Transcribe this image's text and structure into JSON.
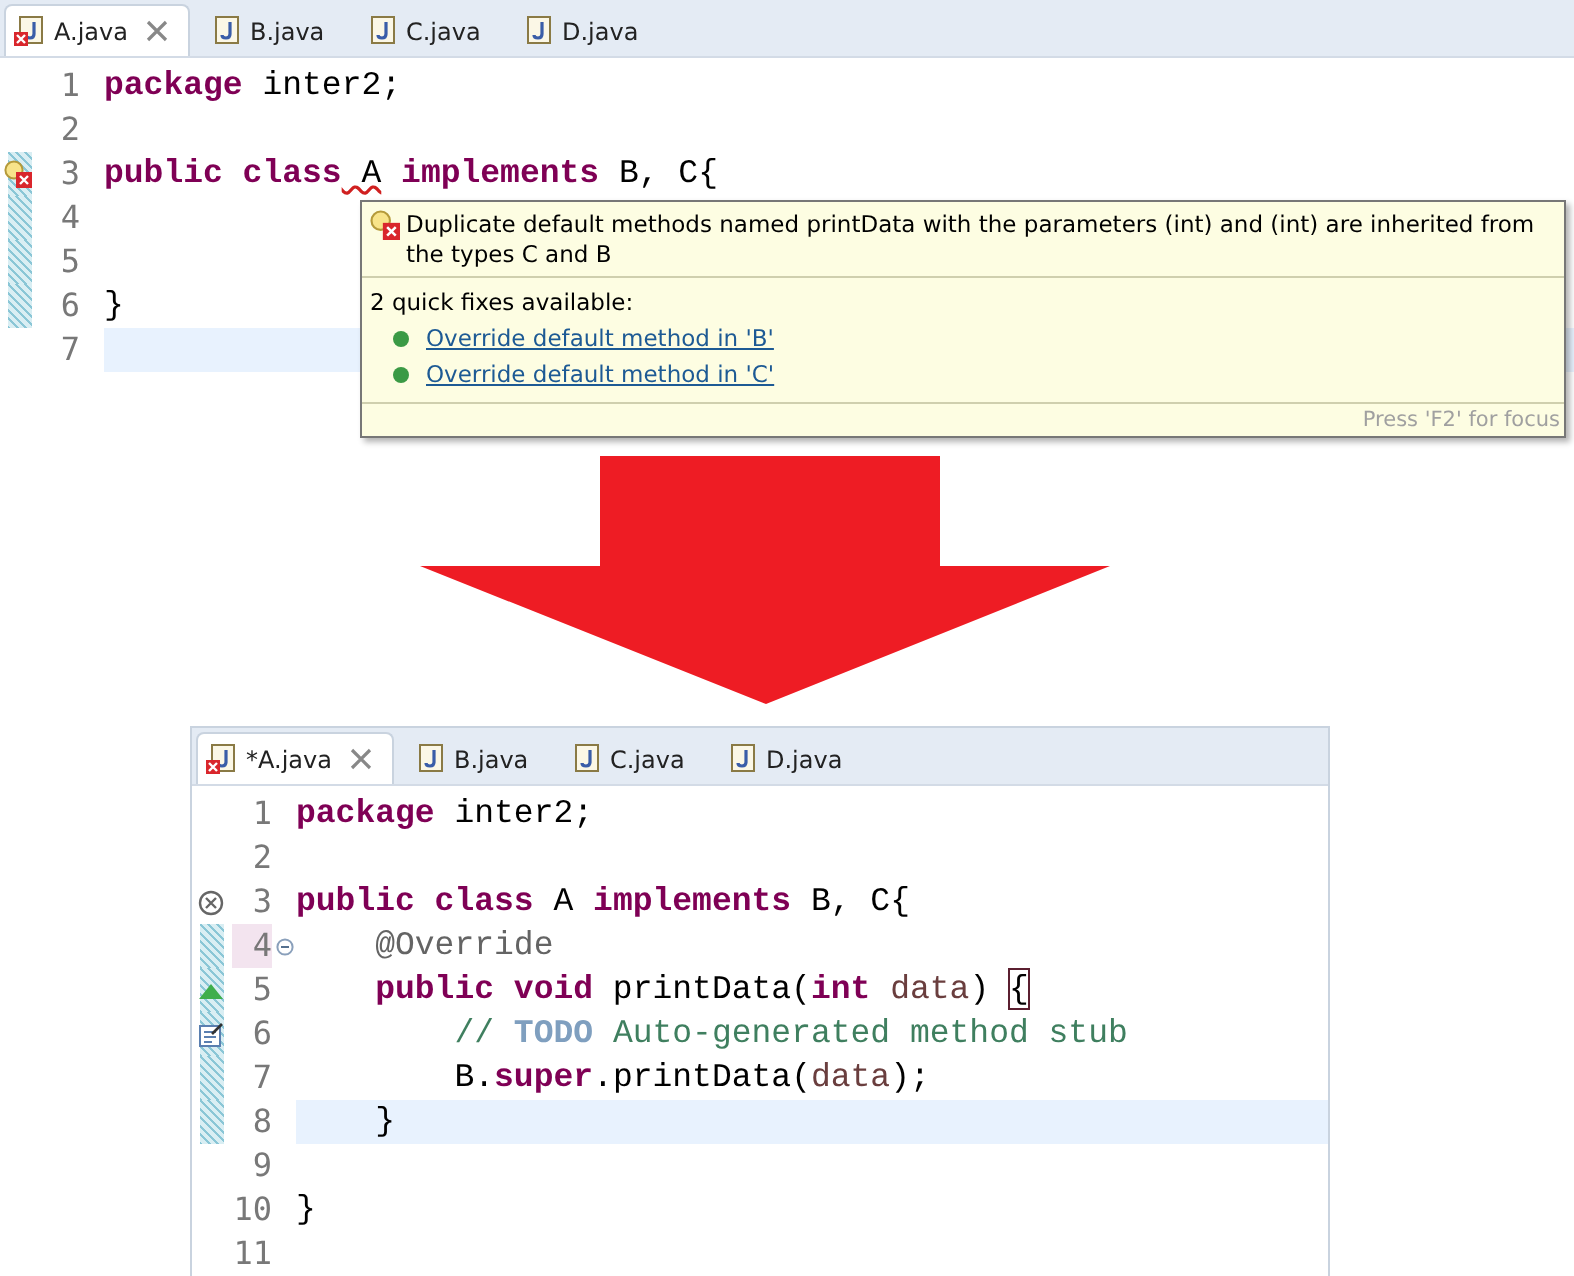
{
  "editors": [
    {
      "tabs": [
        {
          "label": "A.java",
          "selected": true,
          "error": true
        },
        {
          "label": "B.java",
          "selected": false,
          "error": false
        },
        {
          "label": "C.java",
          "selected": false,
          "error": false
        },
        {
          "label": "D.java",
          "selected": false,
          "error": false
        }
      ],
      "lines": [
        {
          "number": "1",
          "changed": false,
          "current": false,
          "fold": false,
          "tokens": [
            {
              "text": "package",
              "kind": "keyword"
            },
            {
              "text": " inter2;",
              "kind": "plain"
            }
          ]
        },
        {
          "number": "2",
          "changed": false,
          "current": false,
          "fold": false
        },
        {
          "number": "3",
          "changed": true,
          "current": false,
          "fold": false,
          "marker": {
            "kind": "bulb-error"
          },
          "tokens": [
            {
              "text": "public class",
              "kind": "keyword"
            },
            {
              "text": " A",
              "kind": "error"
            },
            {
              "text": " implements",
              "kind": "keyword"
            },
            {
              "text": " B, C{",
              "kind": "plain"
            }
          ]
        },
        {
          "number": "4",
          "changed": true,
          "current": false,
          "fold": false
        },
        {
          "number": "5",
          "changed": true,
          "current": false,
          "fold": false
        },
        {
          "number": "6",
          "changed": true,
          "current": false,
          "fold": false,
          "tokens": [
            {
              "text": "}",
              "kind": "plain"
            }
          ]
        },
        {
          "number": "7",
          "changed": false,
          "current": true,
          "fold": false
        }
      ],
      "tooltip": {
        "message": "Duplicate default methods named printData with the parameters (int) and (int) are inherited from the types C and B",
        "heading": "2 quick fixes available:",
        "fixes": [
          "Override default method in 'B'",
          "Override default method in 'C'"
        ],
        "footer": "Press 'F2' for focus"
      }
    },
    {
      "tabs": [
        {
          "label": "*A.java",
          "selected": true,
          "error": true
        },
        {
          "label": "B.java",
          "selected": false,
          "error": false
        },
        {
          "label": "C.java",
          "selected": false,
          "error": false
        },
        {
          "label": "D.java",
          "selected": false,
          "error": false
        }
      ],
      "lines": [
        {
          "number": "1",
          "changed": false,
          "current": false,
          "fold": false,
          "tokens": [
            {
              "text": "package",
              "kind": "keyword"
            },
            {
              "text": " inter2;",
              "kind": "plain"
            }
          ]
        },
        {
          "number": "2",
          "changed": false,
          "current": false,
          "fold": false
        },
        {
          "number": "3",
          "changed": false,
          "current": false,
          "fold": false,
          "marker": {
            "kind": "error"
          },
          "tokens": [
            {
              "text": "public class",
              "kind": "keyword"
            },
            {
              "text": " A",
              "kind": "plain"
            },
            {
              "text": " implements",
              "kind": "keyword"
            },
            {
              "text": " B, C{",
              "kind": "plain"
            }
          ]
        },
        {
          "number": "4",
          "changed": true,
          "current": false,
          "fold": true,
          "tokens": [
            {
              "text": "    @Override",
              "kind": "annotation"
            }
          ]
        },
        {
          "number": "5",
          "changed": true,
          "current": false,
          "fold": false,
          "marker": {
            "kind": "override"
          },
          "tokens": [
            {
              "text": "    public void",
              "kind": "keyword"
            },
            {
              "text": " printData(",
              "kind": "plain"
            },
            {
              "text": "int",
              "kind": "keyword"
            },
            {
              "text": " data",
              "kind": "variable"
            },
            {
              "text": ") ",
              "kind": "plain"
            },
            {
              "text": "{",
              "kind": "bracket"
            }
          ]
        },
        {
          "number": "6",
          "changed": true,
          "current": false,
          "fold": false,
          "marker": {
            "kind": "task"
          },
          "tokens": [
            {
              "text": "        //",
              "kind": "comment"
            },
            {
              "text": " TODO",
              "kind": "todo"
            },
            {
              "text": " Auto-generated method stub",
              "kind": "comment"
            }
          ]
        },
        {
          "number": "7",
          "changed": true,
          "current": false,
          "fold": false,
          "tokens": [
            {
              "text": "        B.",
              "kind": "plain"
            },
            {
              "text": "super",
              "kind": "keyword"
            },
            {
              "text": ".printData(",
              "kind": "plain"
            },
            {
              "text": "data",
              "kind": "variable"
            },
            {
              "text": ");",
              "kind": "plain"
            }
          ]
        },
        {
          "number": "8",
          "changed": true,
          "current": true,
          "fold": false,
          "tokens": [
            {
              "text": "    }",
              "kind": "plain"
            }
          ]
        },
        {
          "number": "9",
          "changed": false,
          "current": false,
          "fold": false
        },
        {
          "number": "10",
          "changed": false,
          "current": false,
          "fold": false,
          "tokens": [
            {
              "text": "}",
              "kind": "plain"
            }
          ]
        },
        {
          "number": "11",
          "changed": false,
          "current": false,
          "fold": false
        }
      ]
    }
  ]
}
